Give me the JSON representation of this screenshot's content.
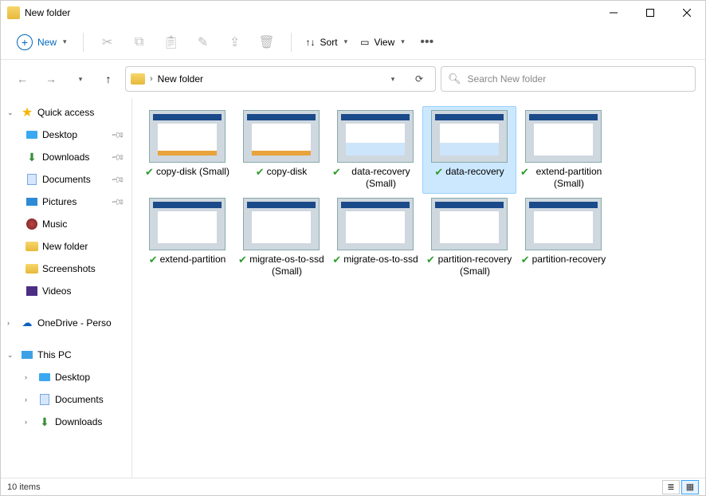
{
  "window": {
    "title": "New folder"
  },
  "toolbar": {
    "new_label": "New",
    "sort_label": "Sort",
    "view_label": "View"
  },
  "breadcrumb": {
    "path": "New folder"
  },
  "search": {
    "placeholder": "Search New folder"
  },
  "sidebar": {
    "quick_access": "Quick access",
    "quick_items": [
      {
        "label": "Desktop",
        "pinned": true
      },
      {
        "label": "Downloads",
        "pinned": true
      },
      {
        "label": "Documents",
        "pinned": true
      },
      {
        "label": "Pictures",
        "pinned": true
      },
      {
        "label": "Music",
        "pinned": false
      },
      {
        "label": "New folder",
        "pinned": false
      },
      {
        "label": "Screenshots",
        "pinned": false
      },
      {
        "label": "Videos",
        "pinned": false
      }
    ],
    "onedrive": "OneDrive - Perso",
    "this_pc": "This PC",
    "pc_items": [
      {
        "label": "Desktop"
      },
      {
        "label": "Documents"
      },
      {
        "label": "Downloads"
      }
    ]
  },
  "files": [
    {
      "name": "copy-disk (Small)",
      "thumb": "orange",
      "selected": false
    },
    {
      "name": "copy-disk",
      "thumb": "orange",
      "selected": false
    },
    {
      "name": "data-recovery (Small)",
      "thumb": "blue",
      "selected": false
    },
    {
      "name": "data-recovery",
      "thumb": "blue",
      "selected": true
    },
    {
      "name": "extend-partition (Small)",
      "thumb": "plain",
      "selected": false
    },
    {
      "name": "extend-partition",
      "thumb": "plain",
      "selected": false
    },
    {
      "name": "migrate-os-to-ssd (Small)",
      "thumb": "plain",
      "selected": false
    },
    {
      "name": "migrate-os-to-ssd",
      "thumb": "plain",
      "selected": false
    },
    {
      "name": "partition-recovery (Small)",
      "thumb": "plain",
      "selected": false
    },
    {
      "name": "partition-recovery",
      "thumb": "plain",
      "selected": false
    }
  ],
  "status": {
    "text": "10 items"
  }
}
